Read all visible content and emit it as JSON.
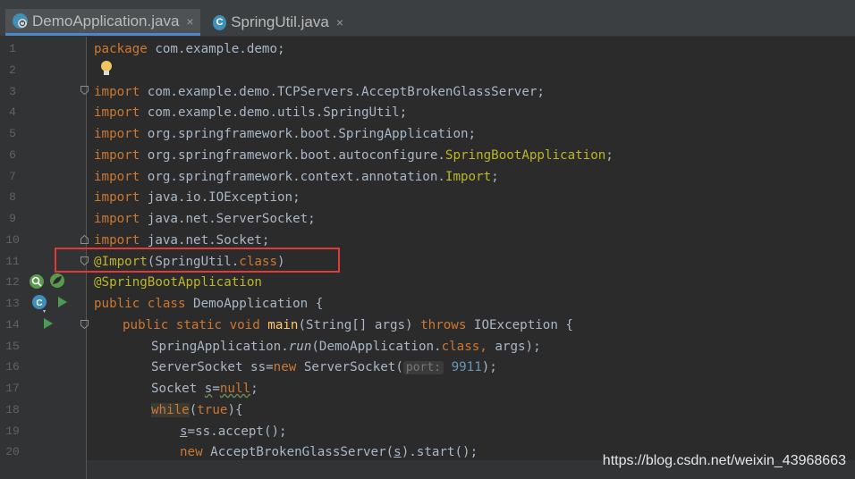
{
  "tabs": [
    {
      "label": "DemoApplication.java",
      "icon": "spring-boot-class-icon",
      "close": "×",
      "active": true
    },
    {
      "label": "SpringUtil.java",
      "icon": "class-c-icon",
      "icon_letter": "C",
      "close": "×",
      "active": false
    }
  ],
  "colors": {
    "keyword": "#cc7832",
    "annotation": "#bbb529",
    "text": "#a9b7c6",
    "number": "#6897bb",
    "highlight_box": "#e03b3b",
    "background": "#2b2b2b"
  },
  "lines": {
    "l1": {
      "n": "1",
      "kw": "package",
      "rest": " com.example.demo;"
    },
    "l2": {
      "n": "2"
    },
    "l3": {
      "n": "3",
      "kw": "import",
      "rest": " com.example.demo.TCPServers.AcceptBrokenGlassServer;"
    },
    "l4": {
      "n": "4",
      "kw": "import",
      "rest": " com.example.demo.utils.SpringUtil;"
    },
    "l5": {
      "n": "5",
      "kw": "import",
      "rest": " org.springframework.boot.SpringApplication;"
    },
    "l6": {
      "n": "6",
      "kw": "import",
      "rest": " org.springframework.boot.autoconfigure.",
      "ann": "SpringBootApplication",
      "end": ";"
    },
    "l7": {
      "n": "7",
      "kw": "import",
      "rest": " org.springframework.context.annotation.",
      "ann": "Import",
      "end": ";"
    },
    "l8": {
      "n": "8",
      "kw": "import",
      "rest": " java.io.IOException;"
    },
    "l9": {
      "n": "9",
      "kw": "import",
      "rest": " java.net.ServerSocket;"
    },
    "l10": {
      "n": "10",
      "kw": "import",
      "rest": " java.net.Socket;"
    },
    "l11": {
      "n": "11",
      "ann": "@Import",
      "rest": "(SpringUtil.",
      "kw": "class",
      "end": ")"
    },
    "l12": {
      "n": "12",
      "ann": "@SpringBootApplication"
    },
    "l13": {
      "n": "13",
      "kw": "public class",
      "rest": " DemoApplication {"
    },
    "l14": {
      "n": "14",
      "kw": "public static void",
      "method": " main",
      "rest": "(String[] args) ",
      "kw2": "throws",
      "end": " IOException {"
    },
    "l15": {
      "n": "15",
      "pre": "SpringApplication.",
      "method": "run",
      "rest": "(DemoApplication.",
      "kw": "class,",
      "end": " args);"
    },
    "l16": {
      "n": "16",
      "pre": "ServerSocket ss=",
      "kw": "new",
      "rest": " ServerSocket(",
      "hint": "port:",
      "num": " 9911",
      "end": ");"
    },
    "l17": {
      "n": "17",
      "pre": "Socket ",
      "var": "s",
      "rest": "=",
      "kw": "null",
      "end": ";"
    },
    "l18": {
      "n": "18",
      "kw": "while",
      "rest": "(",
      "kw2": "true",
      "end": "){"
    },
    "l19": {
      "n": "19",
      "var": "s",
      "rest": "=ss.accept();"
    },
    "l20": {
      "n": "20",
      "kw": "new",
      "rest": " AcceptBrokenGlassServer(",
      "var": "s",
      "end": ").start();"
    }
  },
  "watermark": "https://blog.csdn.net/weixin_43968663"
}
